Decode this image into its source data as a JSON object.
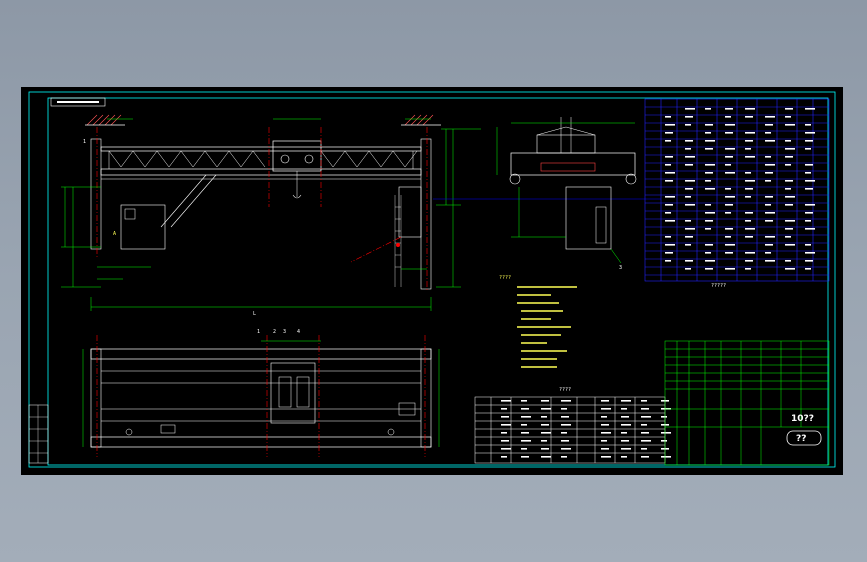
{
  "drawing": {
    "frame_colors": {
      "border": "#00ffff",
      "structure": "#ffffff",
      "dimension": "#00ff00",
      "annotation": "#ffff00",
      "centerline": "#ff0000",
      "table": "#0000ff"
    },
    "section_label_a": "A",
    "part_numbers": [
      "1",
      "2",
      "3",
      "4"
    ],
    "table_caption": "?????",
    "notes_title": "????",
    "parts_list_title": "????",
    "drawing_number": "10?? ",
    "logo_text": "??"
  }
}
